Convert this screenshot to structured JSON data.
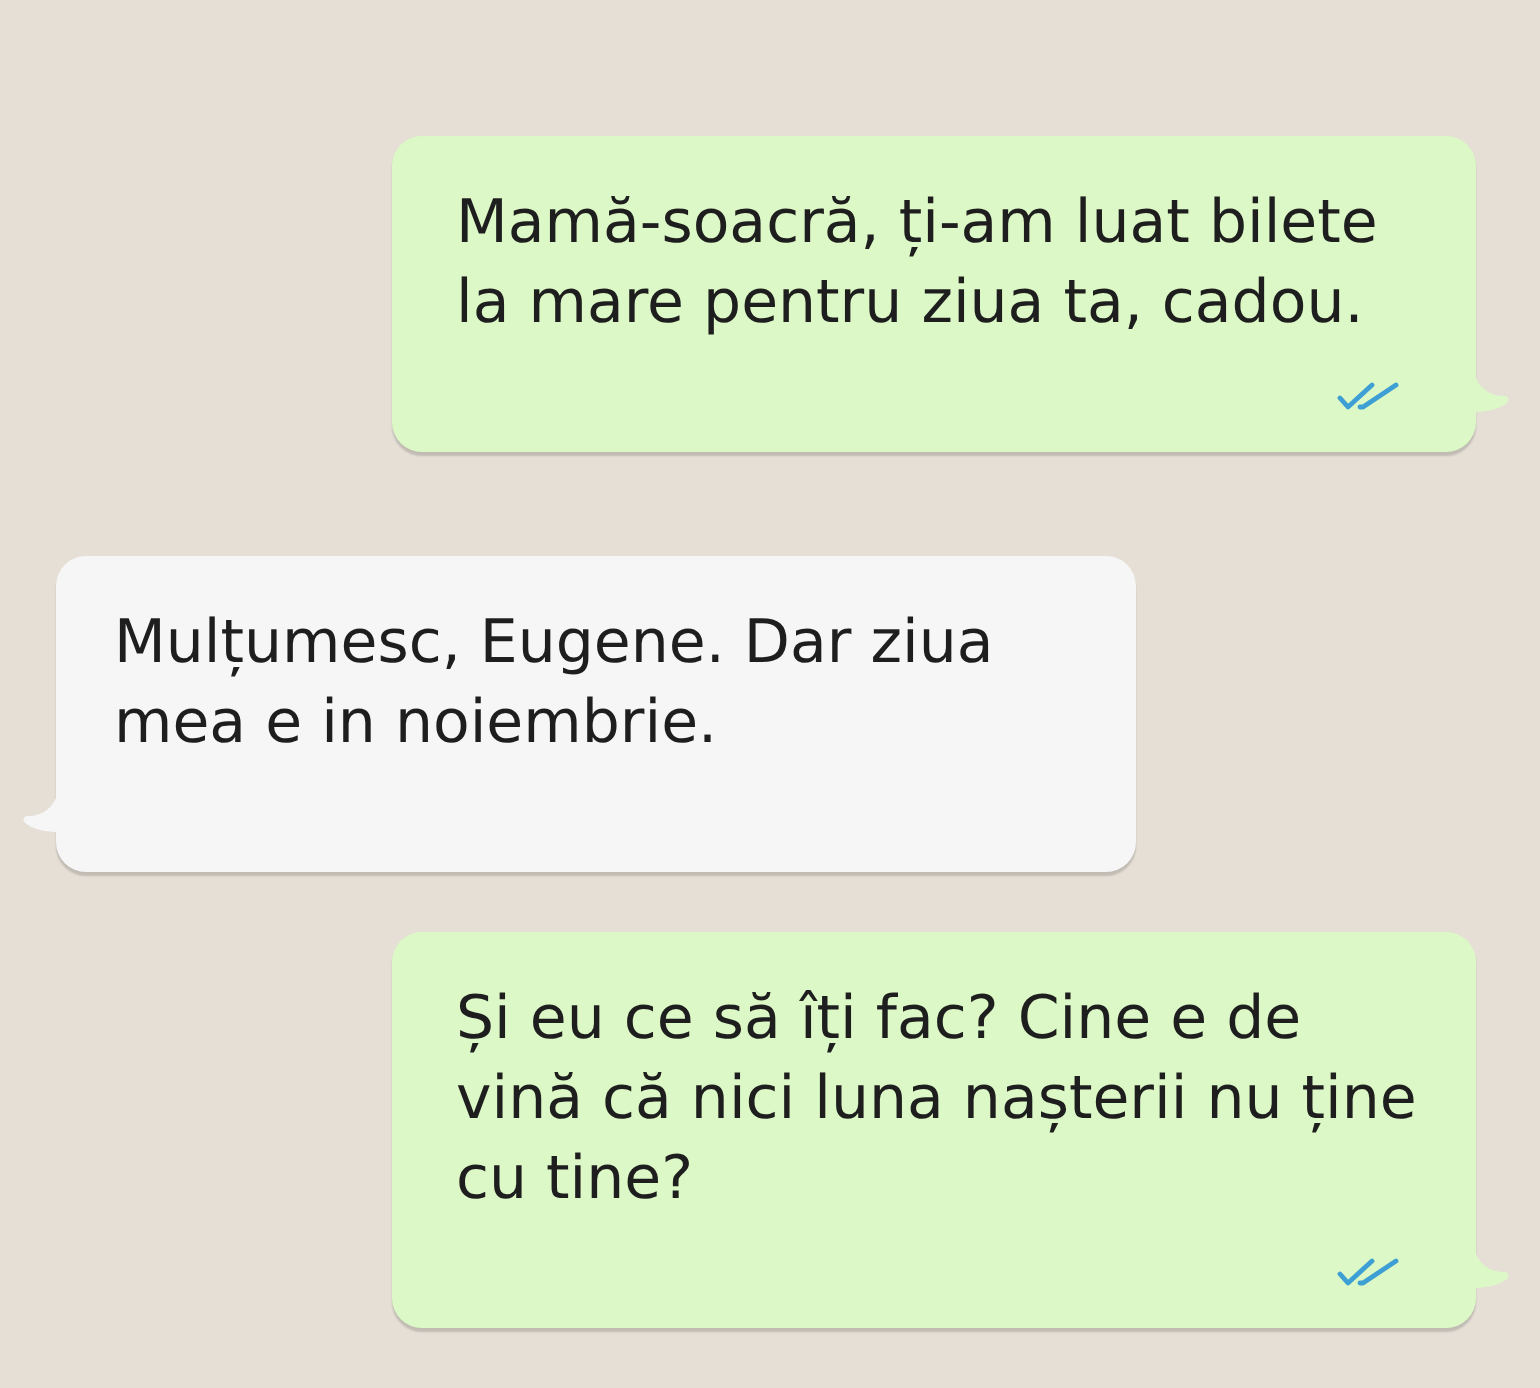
{
  "messages": [
    {
      "kind": "outgoing",
      "text": "Mamă-soacră, ți-am luat bilete la mare pentru ziua ta, cadou.",
      "read": true
    },
    {
      "kind": "incoming",
      "text": "Mulțumesc, Eugene. Dar ziua mea e in noiembrie."
    },
    {
      "kind": "outgoing",
      "text": "Și eu ce să îți fac? Cine e de vină că nici luna nașterii nu ține cu tine?",
      "read": true
    }
  ]
}
